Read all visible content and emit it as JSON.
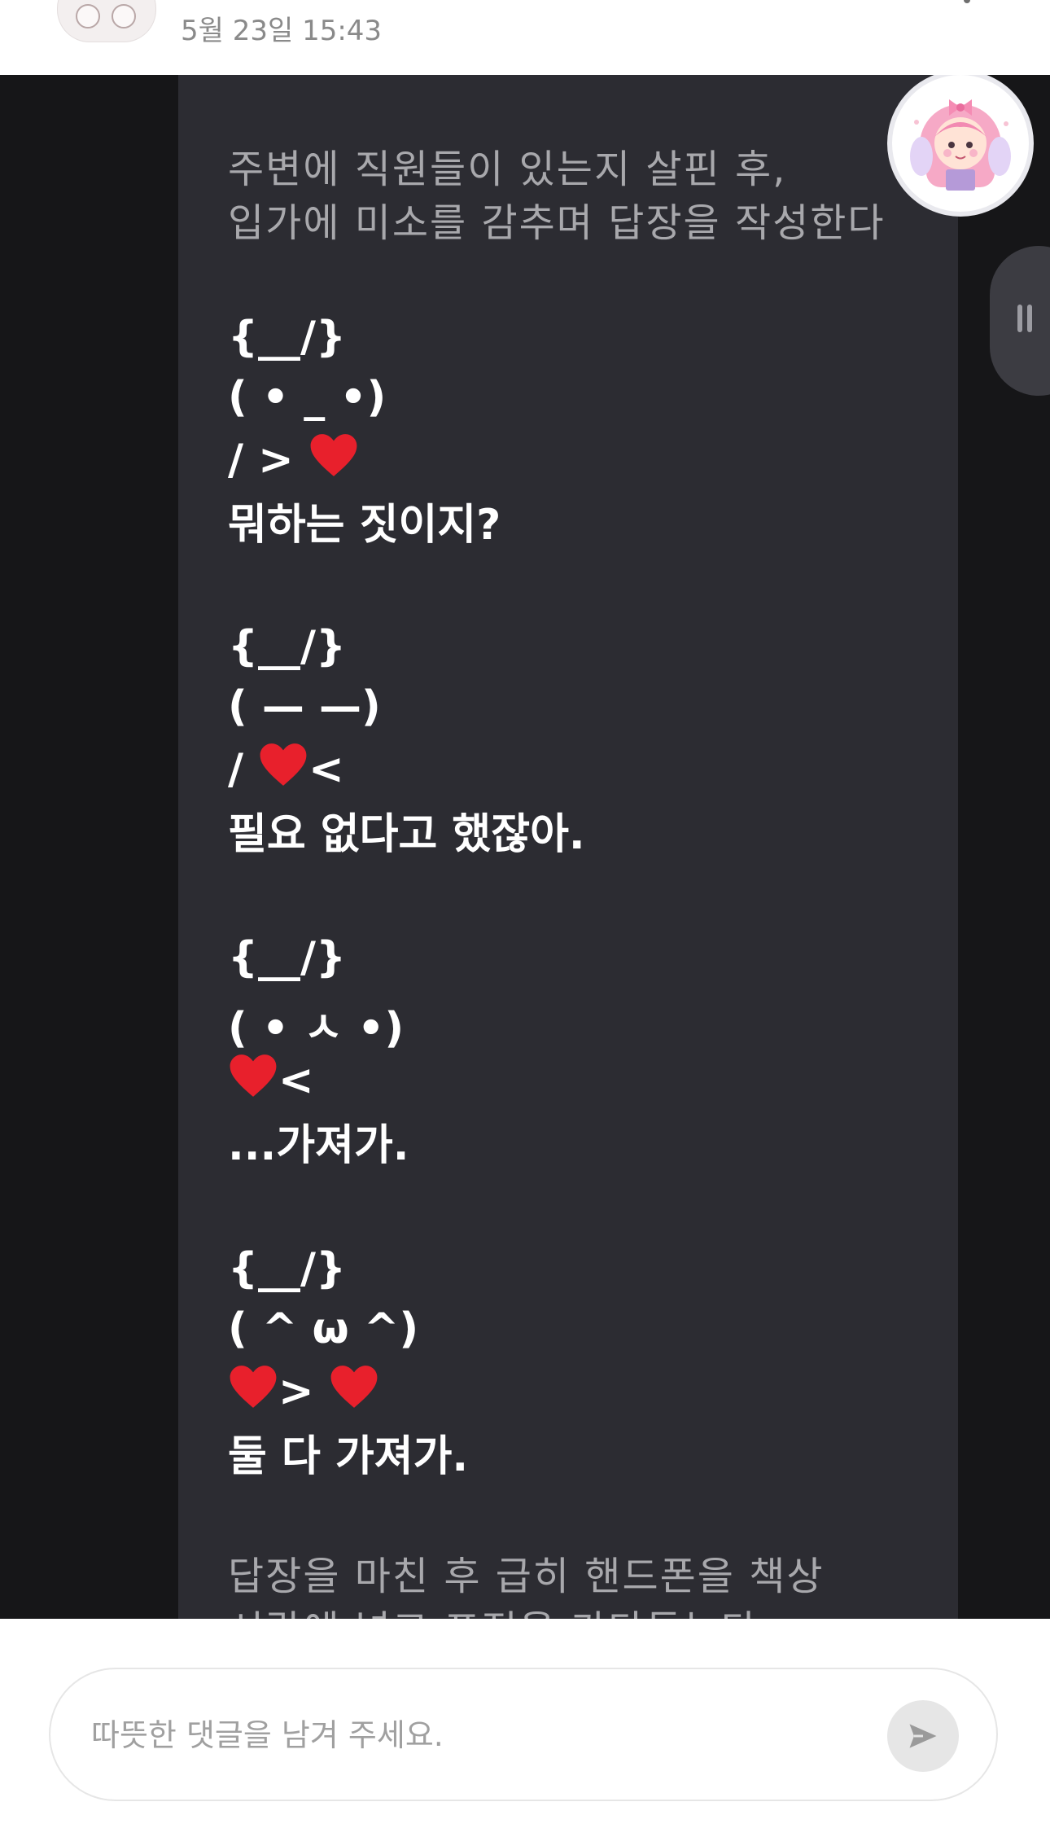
{
  "header": {
    "date": "5월 23일 15:43"
  },
  "message": {
    "narration_top": [
      "주변에 직원들이 있는지 살핀 후,",
      "입가에 미소를 감추며 답장을 작성한다"
    ],
    "blocks": [
      {
        "ears": "{__/}",
        "face": "( • _ •)",
        "pre": "/ > ",
        "mid": "",
        "post": "",
        "text": "뭐하는 짓이지?"
      },
      {
        "ears": "{__/}",
        "face": "( — —)",
        "pre": "/ ",
        "mid": "",
        "post": "<",
        "text": "필요 없다고 했잖아."
      },
      {
        "ears": "{__/}",
        "face": "( • ㅅ •)",
        "pre": "",
        "mid": "",
        "post": "<",
        "text": "...가져가."
      },
      {
        "ears": "{__/}",
        "face": "( ^ ω ^)",
        "pre": "",
        "mid": "> ",
        "post": "",
        "text": "둘 다 가져가."
      }
    ],
    "narration_bottom": [
      "답장을 마친 후 급히 핸드폰을 책상",
      "시랍에 넣고 표정을 가다듬는다"
    ]
  },
  "comment": {
    "placeholder": "따뜻한 댓글을 남겨 주세요."
  },
  "icons": {
    "heart": "heart-icon",
    "send": "send-icon",
    "more": "more-vertical-icon"
  },
  "colors": {
    "panel": "#2c2c32",
    "background": "#161618",
    "heart": "#e8202c"
  }
}
